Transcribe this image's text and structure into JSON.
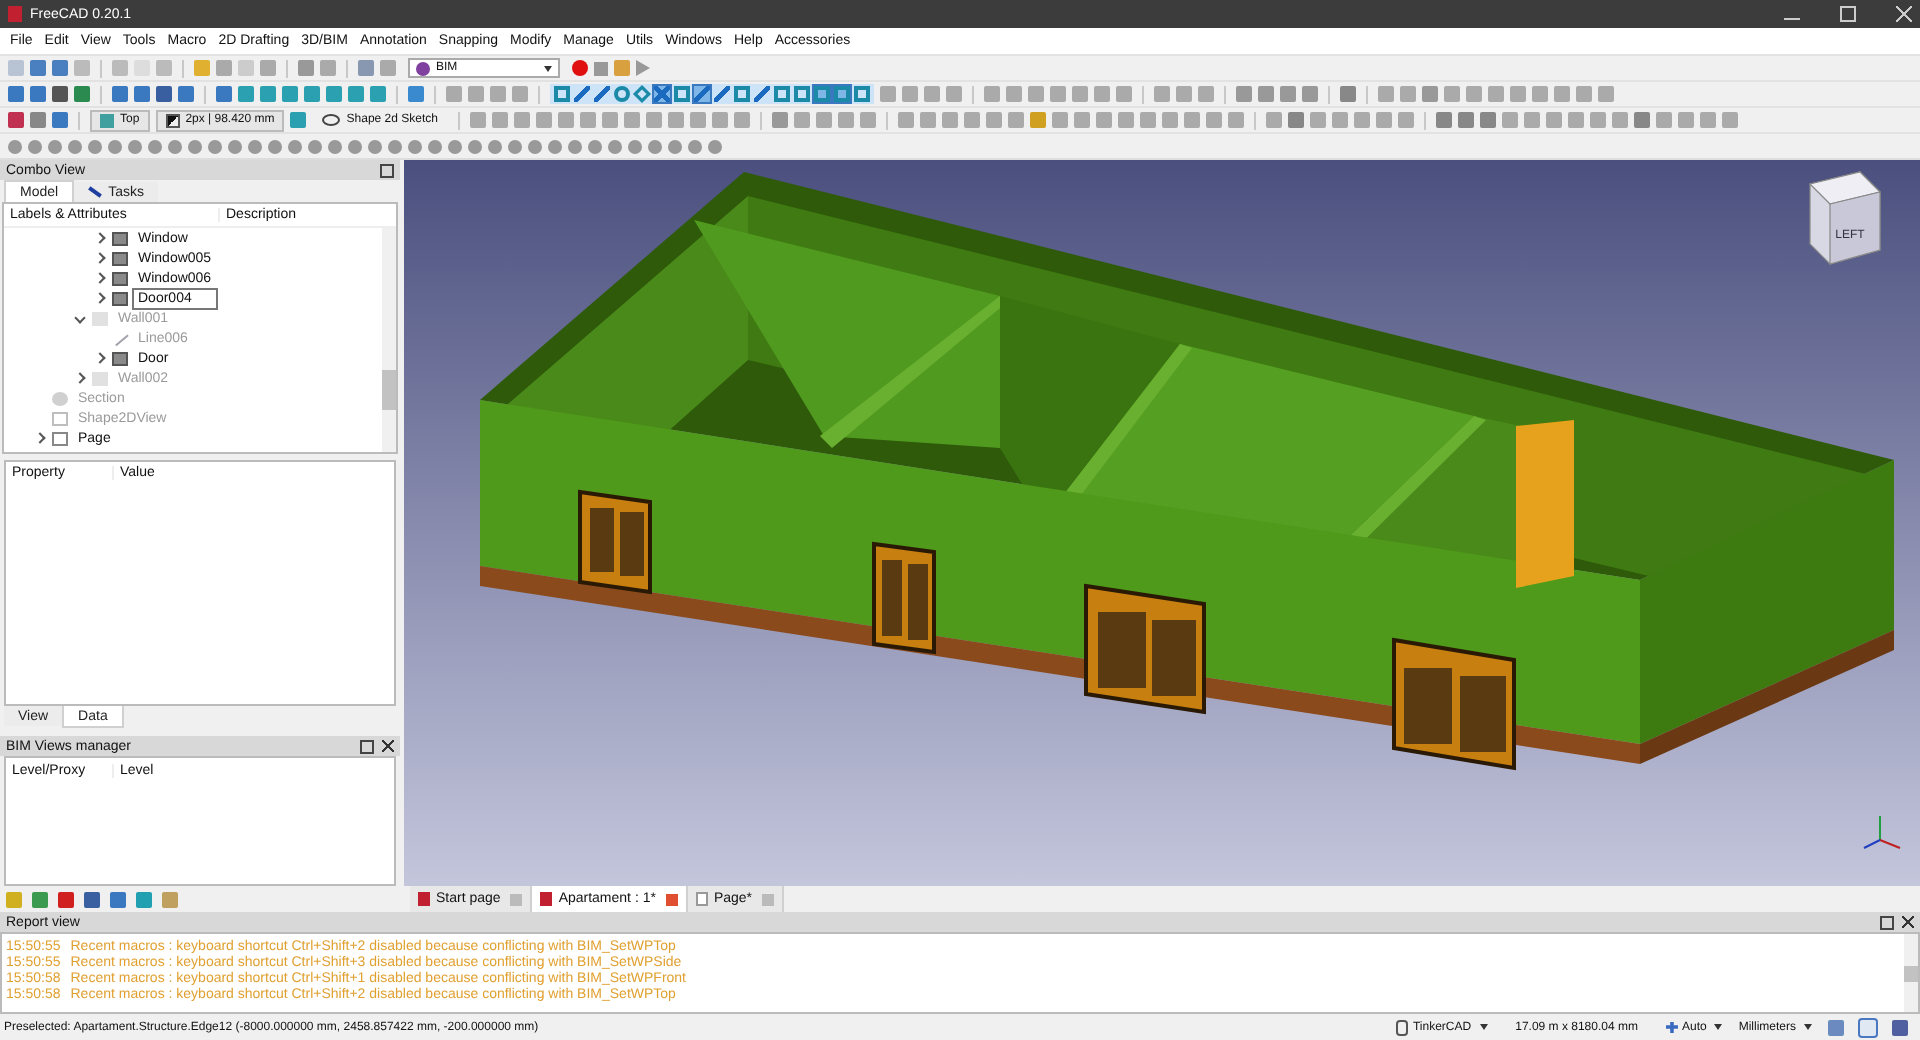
{
  "window": {
    "title": "FreeCAD 0.20.1"
  },
  "menu": [
    "File",
    "Edit",
    "View",
    "Tools",
    "Macro",
    "2D Drafting",
    "3D/BIM",
    "Annotation",
    "Snapping",
    "Modify",
    "Manage",
    "Utils",
    "Windows",
    "Help",
    "Accessories"
  ],
  "toolbar": {
    "workbench": "BIM",
    "view_button": "Top",
    "line_style": "2px | 98.420 mm",
    "sketch_button": "Shape 2d Sketch",
    "snaps": [
      {
        "on": false
      },
      {
        "on": false
      },
      {
        "on": false
      },
      {
        "on": false
      },
      {
        "on": false
      },
      {
        "on": true
      },
      {
        "on": false
      },
      {
        "on": true
      },
      {
        "on": false
      },
      {
        "on": false
      },
      {
        "on": false
      },
      {
        "on": false
      },
      {
        "on": false
      },
      {
        "on": true
      },
      {
        "on": true
      },
      {
        "on": false
      }
    ]
  },
  "combo_view": {
    "title": "Combo View",
    "tabs": [
      {
        "label": "Model",
        "selected": true
      },
      {
        "label": "Tasks",
        "selected": false
      }
    ],
    "tree": {
      "columns": [
        "Labels & Attributes",
        "Description"
      ],
      "items": [
        {
          "children": [
            {
              "children": [
                {
                  "children": [
                    {
                      "label": "Window",
                      "kind": "window",
                      "expanded": false,
                      "visible": true,
                      "selected": false
                    },
                    {
                      "label": "Window005",
                      "kind": "window",
                      "expanded": false,
                      "visible": true,
                      "selected": false
                    },
                    {
                      "label": "Window006",
                      "kind": "window",
                      "expanded": false,
                      "visible": true,
                      "selected": false
                    },
                    {
                      "label": "Door004",
                      "kind": "window",
                      "expanded": false,
                      "visible": true,
                      "selected": true
                    }
                  ]
                },
                {
                  "label": "Wall001",
                  "kind": "wall",
                  "expanded": true,
                  "visible": false,
                  "selected": false,
                  "children": [
                    {
                      "label": "Line006",
                      "kind": "line",
                      "visible": false,
                      "selected": false
                    },
                    {
                      "label": "Door",
                      "kind": "window",
                      "expanded": false,
                      "visible": true,
                      "selected": false
                    }
                  ]
                },
                {
                  "label": "Wall002",
                  "kind": "wall",
                  "expanded": false,
                  "visible": false,
                  "selected": false
                }
              ]
            }
          ]
        },
        {
          "label": "Section",
          "kind": "section",
          "visible": false,
          "selected": false
        },
        {
          "label": "Shape2DView",
          "kind": "shape2d",
          "visible": false,
          "selected": false
        },
        {
          "label": "Page",
          "kind": "page",
          "expanded": false,
          "visible": true,
          "selected": false
        }
      ]
    },
    "properties": {
      "columns": [
        "Property",
        "Value"
      ],
      "tabs": [
        {
          "label": "View",
          "selected": false
        },
        {
          "label": "Data",
          "selected": true
        }
      ]
    }
  },
  "bim_views": {
    "title": "BIM Views manager",
    "columns": [
      "Level/Proxy",
      "Level"
    ]
  },
  "viewport": {
    "nav_cube_label": "LEFT",
    "tabs": [
      {
        "label": "Start page",
        "kind": "start",
        "selected": false
      },
      {
        "label": "Apartament : 1*",
        "kind": "document",
        "selected": true
      },
      {
        "label": "Page*",
        "kind": "page",
        "selected": false
      }
    ]
  },
  "report": {
    "title": "Report view",
    "lines": [
      {
        "time": "15:50:55",
        "text": "Recent macros : keyboard shortcut Ctrl+Shift+2 disabled because conflicting with BIM_SetWPTop"
      },
      {
        "time": "15:50:55",
        "text": "Recent macros : keyboard shortcut Ctrl+Shift+3 disabled because conflicting with BIM_SetWPSide"
      },
      {
        "time": "15:50:58",
        "text": "Recent macros : keyboard shortcut Ctrl+Shift+1 disabled because conflicting with BIM_SetWPFront"
      },
      {
        "time": "15:50:58",
        "text": "Recent macros : keyboard shortcut Ctrl+Shift+2 disabled because conflicting with BIM_SetWPTop"
      }
    ]
  },
  "status_bar": {
    "message": "Preselected: Apartament.Structure.Edge12 (-8000.000000 mm, 2458.857422 mm, -200.000000 mm)",
    "navigation": "TinkerCAD",
    "dimensions": "17.09 m x 8180.04 mm",
    "mode": "Auto",
    "units": "Millimeters"
  }
}
